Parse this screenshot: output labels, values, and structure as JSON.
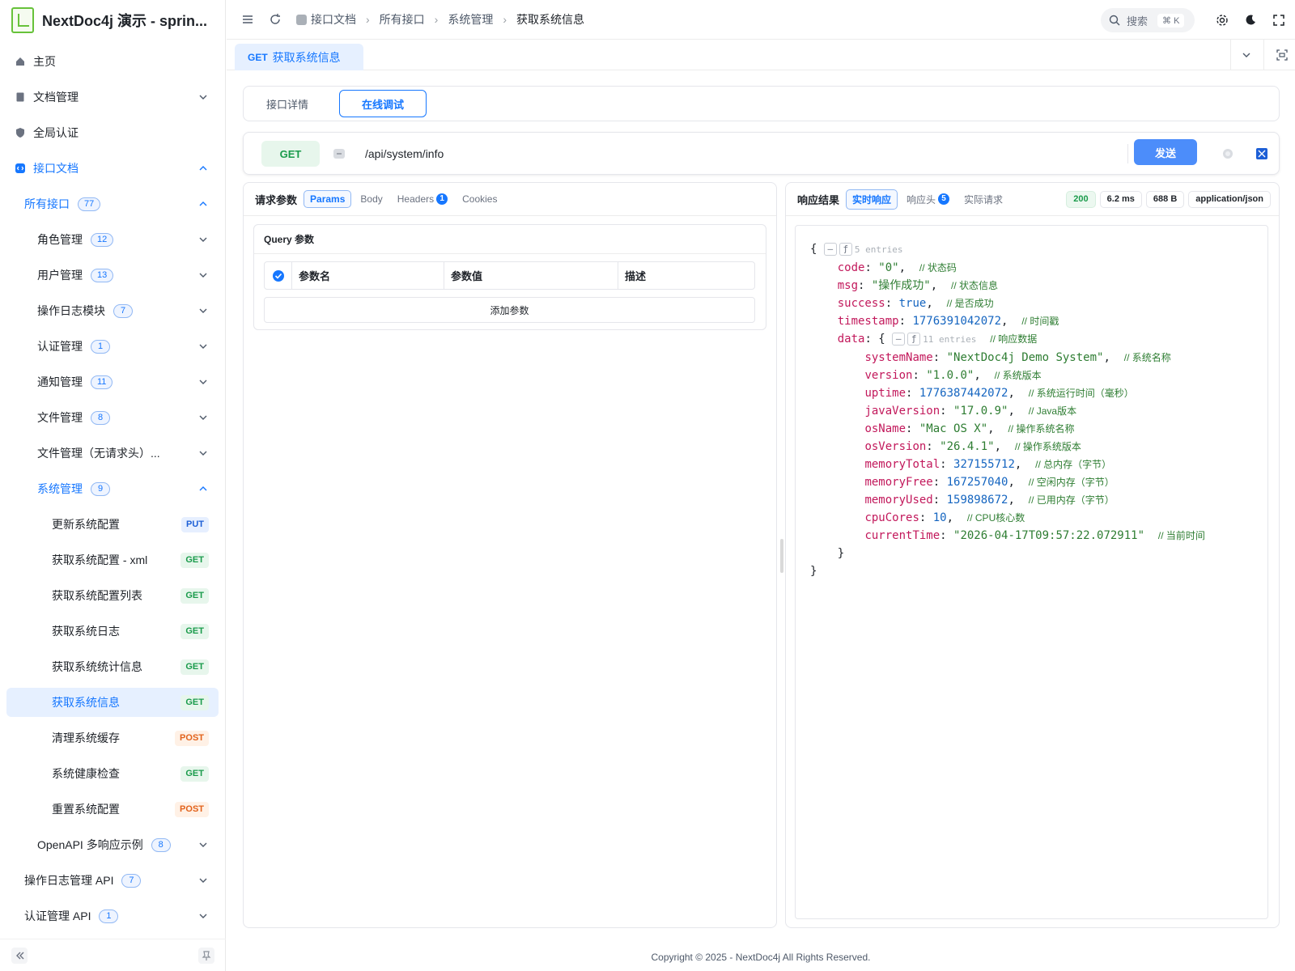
{
  "app": {
    "title": "NextDoc4j 演示 - sprin..."
  },
  "sidebar": {
    "top_items": [
      {
        "label": "主页"
      },
      {
        "label": "文档管理"
      },
      {
        "label": "全局认证"
      },
      {
        "label": "接口文档"
      }
    ],
    "all_apis": {
      "label": "所有接口",
      "count": "77"
    },
    "groups": [
      {
        "label": "角色管理",
        "count": "12"
      },
      {
        "label": "用户管理",
        "count": "13"
      },
      {
        "label": "操作日志模块",
        "count": "7"
      },
      {
        "label": "认证管理",
        "count": "1"
      },
      {
        "label": "通知管理",
        "count": "11"
      },
      {
        "label": "文件管理",
        "count": "8"
      },
      {
        "label": "文件管理（无请求头）..."
      },
      {
        "label": "系统管理",
        "count": "9"
      }
    ],
    "system_items": [
      {
        "label": "更新系统配置",
        "method": "PUT"
      },
      {
        "label": "获取系统配置 - xml",
        "method": "GET"
      },
      {
        "label": "获取系统配置列表",
        "method": "GET"
      },
      {
        "label": "获取系统日志",
        "method": "GET"
      },
      {
        "label": "获取系统统计信息",
        "method": "GET"
      },
      {
        "label": "获取系统信息",
        "method": "GET"
      },
      {
        "label": "清理系统缓存",
        "method": "POST"
      },
      {
        "label": "系统健康检查",
        "method": "GET"
      },
      {
        "label": "重置系统配置",
        "method": "POST"
      }
    ],
    "openapi": {
      "label": "OpenAPI 多响应示例",
      "count": "8"
    },
    "bottom_groups": [
      {
        "label": "操作日志管理 API",
        "count": "7"
      },
      {
        "label": "认证管理 API",
        "count": "1"
      }
    ]
  },
  "topbar": {
    "breadcrumb": [
      "接口文档",
      "所有接口",
      "系统管理",
      "获取系统信息"
    ],
    "search_label": "搜索",
    "search_kbd": "⌘ K"
  },
  "page_tab": {
    "method": "GET",
    "label": "获取系统信息"
  },
  "segment": {
    "detail": "接口详情",
    "debug": "在线调试"
  },
  "request": {
    "method": "GET",
    "url": "/api/system/info",
    "send": "发送"
  },
  "params_panel": {
    "title": "请求参数",
    "tabs": [
      "Params",
      "Body",
      "Headers",
      "Cookies"
    ],
    "headers_count": "1",
    "query_title": "Query 参数",
    "columns": [
      "参数名",
      "参数值",
      "描述"
    ],
    "add_param": "添加参数"
  },
  "response_panel": {
    "title": "响应结果",
    "tabs": [
      "实时响应",
      "响应头",
      "实际请求"
    ],
    "headers_count": "5",
    "status": "200",
    "time": "6.2 ms",
    "size": "688 B",
    "content_type": "application/json",
    "root_entries": "5 entries",
    "data_entries": "11 entries",
    "lines": [
      {
        "key": "code",
        "value": "\"0\"",
        "type": "s",
        "comment": "// 状态码"
      },
      {
        "key": "msg",
        "value": "\"操作成功\"",
        "type": "s",
        "comment": "// 状态信息"
      },
      {
        "key": "success",
        "value": "true",
        "type": "b",
        "comment": "// 是否成功"
      },
      {
        "key": "timestamp",
        "value": "1776391042072",
        "type": "n",
        "comment": "// 时间戳"
      }
    ],
    "data_comment": "// 响应数据",
    "data_lines": [
      {
        "key": "systemName",
        "value": "\"NextDoc4j Demo System\"",
        "type": "s",
        "comment": "// 系统名称"
      },
      {
        "key": "version",
        "value": "\"1.0.0\"",
        "type": "s",
        "comment": "// 系统版本"
      },
      {
        "key": "uptime",
        "value": "1776387442072",
        "type": "n",
        "comment": "// 系统运行时间（毫秒）"
      },
      {
        "key": "javaVersion",
        "value": "\"17.0.9\"",
        "type": "s",
        "comment": "// Java版本"
      },
      {
        "key": "osName",
        "value": "\"Mac OS X\"",
        "type": "s",
        "comment": "// 操作系统名称"
      },
      {
        "key": "osVersion",
        "value": "\"26.4.1\"",
        "type": "s",
        "comment": "// 操作系统版本"
      },
      {
        "key": "memoryTotal",
        "value": "327155712",
        "type": "n",
        "comment": "// 总内存（字节）"
      },
      {
        "key": "memoryFree",
        "value": "167257040",
        "type": "n",
        "comment": "// 空闲内存（字节）"
      },
      {
        "key": "memoryUsed",
        "value": "159898672",
        "type": "n",
        "comment": "// 已用内存（字节）"
      },
      {
        "key": "cpuCores",
        "value": "10",
        "type": "n",
        "comment": "// CPU核心数"
      },
      {
        "key": "currentTime",
        "value": "\"2026-04-17T09:57:22.072911\"",
        "type": "s",
        "comment": "// 当前时间",
        "last": true
      }
    ]
  },
  "footer": {
    "text": "Copyright © 2025 - NextDoc4j All Rights Reserved."
  }
}
